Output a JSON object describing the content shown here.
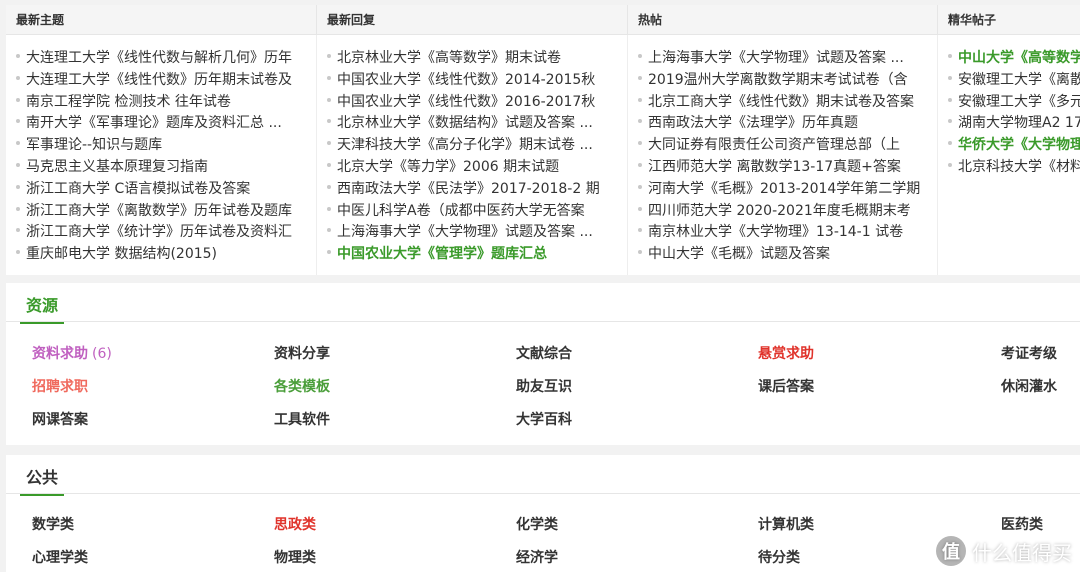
{
  "columns": [
    {
      "title": "最新主题",
      "items": [
        {
          "text": "大连理工大学《线性代数与解析几何》历年"
        },
        {
          "text": "大连理工大学《线性代数》历年期末试卷及"
        },
        {
          "text": "南京工程学院 检测技术 往年试卷"
        },
        {
          "text": "南开大学《军事理论》题库及资料汇总 ..."
        },
        {
          "text": "军事理论--知识与题库"
        },
        {
          "text": "马克思主义基本原理复习指南"
        },
        {
          "text": "浙江工商大学 C语言模拟试卷及答案"
        },
        {
          "text": "浙江工商大学《离散数学》历年试卷及题库"
        },
        {
          "text": "浙江工商大学《统计学》历年试卷及资料汇"
        },
        {
          "text": "重庆邮电大学 数据结构(2015)"
        }
      ]
    },
    {
      "title": "最新回复",
      "items": [
        {
          "text": "北京林业大学《高等数学》期末试卷"
        },
        {
          "text": "中国农业大学《线性代数》2014-2015秋"
        },
        {
          "text": "中国农业大学《线性代数》2016-2017秋"
        },
        {
          "text": "北京林业大学《数据结构》试题及答案 ..."
        },
        {
          "text": "天津科技大学《高分子化学》期末试卷 ..."
        },
        {
          "text": "北京大学《等力学》2006 期末试题"
        },
        {
          "text": "西南政法大学《民法学》2017-2018-2 期"
        },
        {
          "text": "中医儿科学A卷（成都中医药大学无答案"
        },
        {
          "text": "上海海事大学《大学物理》试题及答案 ..."
        },
        {
          "text": "中国农业大学《管理学》题库汇总",
          "highlight": true
        }
      ]
    },
    {
      "title": "热帖",
      "items": [
        {
          "text": "上海海事大学《大学物理》试题及答案 ..."
        },
        {
          "text": "2019温州大学离散数学期末考试试卷（含"
        },
        {
          "text": "北京工商大学《线性代数》期末试卷及答案"
        },
        {
          "text": "西南政法大学《法理学》历年真题"
        },
        {
          "text": "大同证券有限责任公司资产管理总部（上"
        },
        {
          "text": "江西师范大学 离散数学13-17真题+答案"
        },
        {
          "text": "河南大学《毛概》2013-2014学年第二学期"
        },
        {
          "text": "四川师范大学 2020-2021年度毛概期末考"
        },
        {
          "text": "南京林业大学《大学物理》13-14-1 试卷"
        },
        {
          "text": "中山大学《毛概》试题及答案"
        }
      ]
    },
    {
      "title": "精华帖子",
      "items": [
        {
          "text": "中山大学《高等数学",
          "highlight": true
        },
        {
          "text": "安徽理工大学《离散"
        },
        {
          "text": "安徽理工大学《多元"
        },
        {
          "text": "湖南大学物理A2 17"
        },
        {
          "text": "华侨大学《大学物理",
          "highlight": true
        },
        {
          "text": "北京科技大学《材料"
        }
      ]
    }
  ],
  "resources": {
    "title": "资源",
    "items": [
      {
        "label": "资料求助",
        "count": "(6)",
        "color": "#c060c0"
      },
      {
        "label": "资料分享",
        "color": "#333333"
      },
      {
        "label": "文献综合",
        "color": "#333333"
      },
      {
        "label": "悬赏求助",
        "color": "#e0332b"
      },
      {
        "label": "考证考级",
        "color": "#333333"
      },
      {
        "label": "招聘求职",
        "color": "#f06a5e"
      },
      {
        "label": "各类模板",
        "color": "#4a9e3a"
      },
      {
        "label": "助友互识",
        "color": "#333333"
      },
      {
        "label": "课后答案",
        "color": "#333333"
      },
      {
        "label": "休闲灌水",
        "color": "#333333"
      },
      {
        "label": "网课答案",
        "color": "#333333"
      },
      {
        "label": "工具软件",
        "color": "#333333"
      },
      {
        "label": "大学百科",
        "color": "#333333"
      }
    ]
  },
  "public": {
    "title": "公共",
    "items": [
      {
        "label": "数学类",
        "color": "#333333"
      },
      {
        "label": "思政类",
        "color": "#e0332b"
      },
      {
        "label": "化学类",
        "color": "#333333"
      },
      {
        "label": "计算机类",
        "color": "#333333"
      },
      {
        "label": "医药类",
        "color": "#333333"
      },
      {
        "label": "心理学类",
        "color": "#333333"
      },
      {
        "label": "物理类",
        "color": "#333333"
      },
      {
        "label": "经济学",
        "color": "#333333"
      },
      {
        "label": "待分类",
        "color": "#333333"
      }
    ]
  },
  "watermark": {
    "badge": "值",
    "text": "什么值得买"
  }
}
